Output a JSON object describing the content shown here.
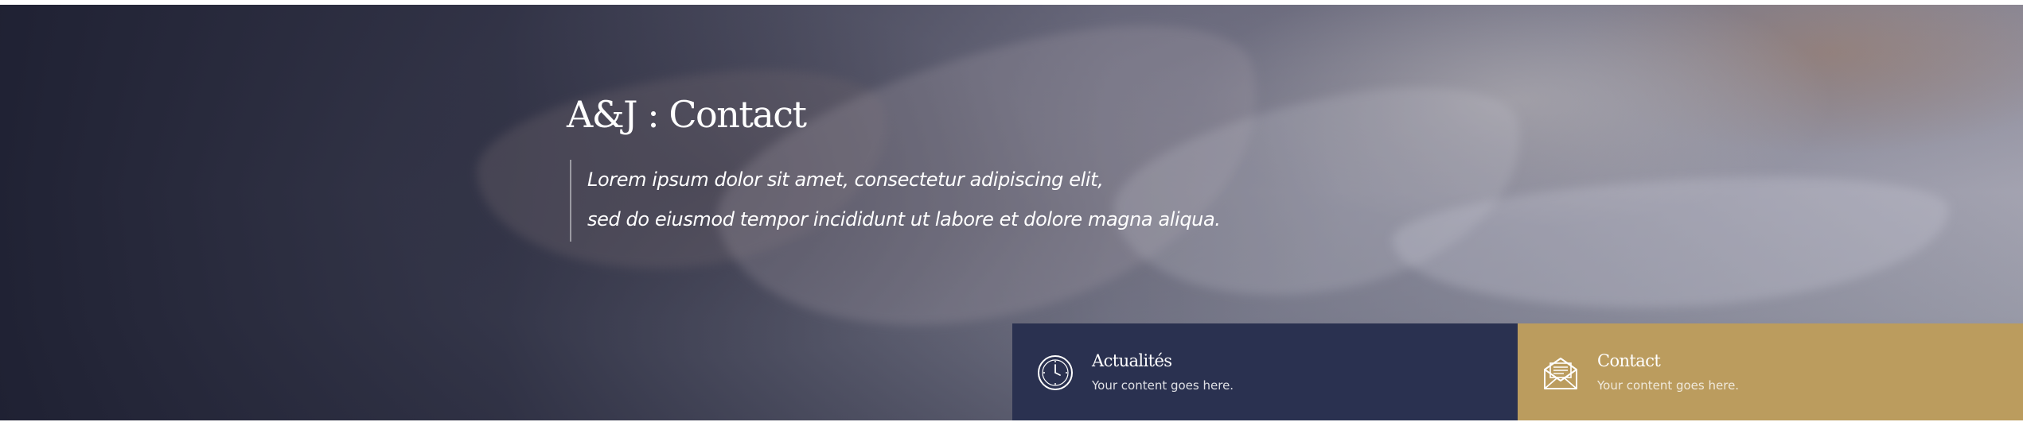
{
  "hero": {
    "title": "A&J : Contact",
    "quote_lines": [
      "Lorem ipsum dolor sit amet, consectetur adipiscing elit,",
      "sed do eiusmod tempor incididunt ut labore et dolore magna aliqua."
    ]
  },
  "cards": [
    {
      "title": "Actualités",
      "subtitle": "Your content goes here.",
      "icon": "clock-icon",
      "color": "#2a3150"
    },
    {
      "title": "Contact",
      "subtitle": "Your content goes here.",
      "icon": "envelope-letter-icon",
      "color": "#bb9c5e"
    }
  ],
  "colors": {
    "overlay_dark": "#1c1e30",
    "card_navy": "#2a3150",
    "card_gold": "#bb9c5e",
    "text": "#ffffff"
  }
}
